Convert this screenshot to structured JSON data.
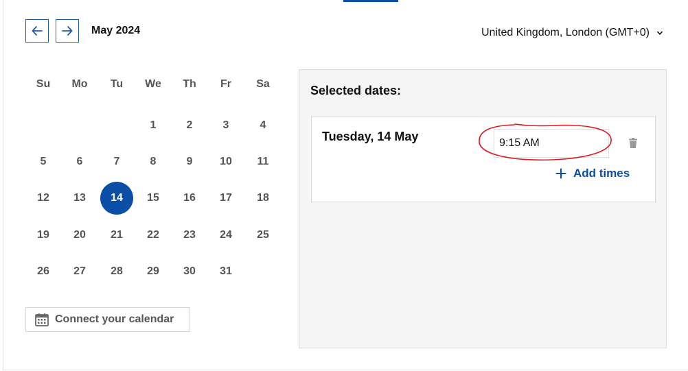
{
  "calendar": {
    "month_label": "May 2024",
    "weekdays": [
      "Su",
      "Mo",
      "Tu",
      "We",
      "Th",
      "Fr",
      "Sa"
    ],
    "weeks": [
      [
        "",
        "",
        "",
        "1",
        "2",
        "3",
        "4"
      ],
      [
        "5",
        "6",
        "7",
        "8",
        "9",
        "10",
        "11"
      ],
      [
        "12",
        "13",
        "14",
        "15",
        "16",
        "17",
        "18"
      ],
      [
        "19",
        "20",
        "21",
        "22",
        "23",
        "24",
        "25"
      ],
      [
        "26",
        "27",
        "28",
        "29",
        "30",
        "31",
        ""
      ]
    ],
    "selected_day": "14",
    "prev_icon": "arrow-left-icon",
    "next_icon": "arrow-right-icon"
  },
  "timezone": {
    "label": "United Kingdom, London (GMT+0)",
    "icon": "chevron-down-icon"
  },
  "connect_calendar": {
    "label": "Connect your calendar",
    "icon": "calendar-icon"
  },
  "selected_panel": {
    "title": "Selected dates:",
    "entries": [
      {
        "date_label": "Tuesday, 14 May",
        "time_value": "9:15 AM",
        "delete_icon": "trash-icon",
        "add_times_label": "Add times",
        "add_icon": "plus-icon"
      }
    ]
  },
  "colors": {
    "accent": "#0a4ea6",
    "annotation": "#e0141e",
    "panel_bg": "#f5f5f5"
  }
}
